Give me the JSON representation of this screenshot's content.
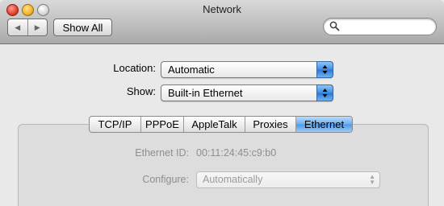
{
  "window": {
    "title": "Network"
  },
  "toolbar": {
    "back_icon": "left-arrow-icon",
    "forward_icon": "right-arrow-icon",
    "show_all_label": "Show All",
    "search_placeholder": ""
  },
  "location": {
    "label": "Location:",
    "value": "Automatic"
  },
  "show": {
    "label": "Show:",
    "value": "Built-in Ethernet"
  },
  "tabs": [
    {
      "label": "TCP/IP",
      "active": false
    },
    {
      "label": "PPPoE",
      "active": false
    },
    {
      "label": "AppleTalk",
      "active": false
    },
    {
      "label": "Proxies",
      "active": false
    },
    {
      "label": "Ethernet",
      "active": true
    }
  ],
  "ethernet": {
    "id_label": "Ethernet ID:",
    "id_value": "00:11:24:45:c9:b0",
    "configure_label": "Configure:",
    "configure_value": "Automatically"
  },
  "colors": {
    "accent": "#4d98ea",
    "disabled_text": "#8e8e8e"
  }
}
